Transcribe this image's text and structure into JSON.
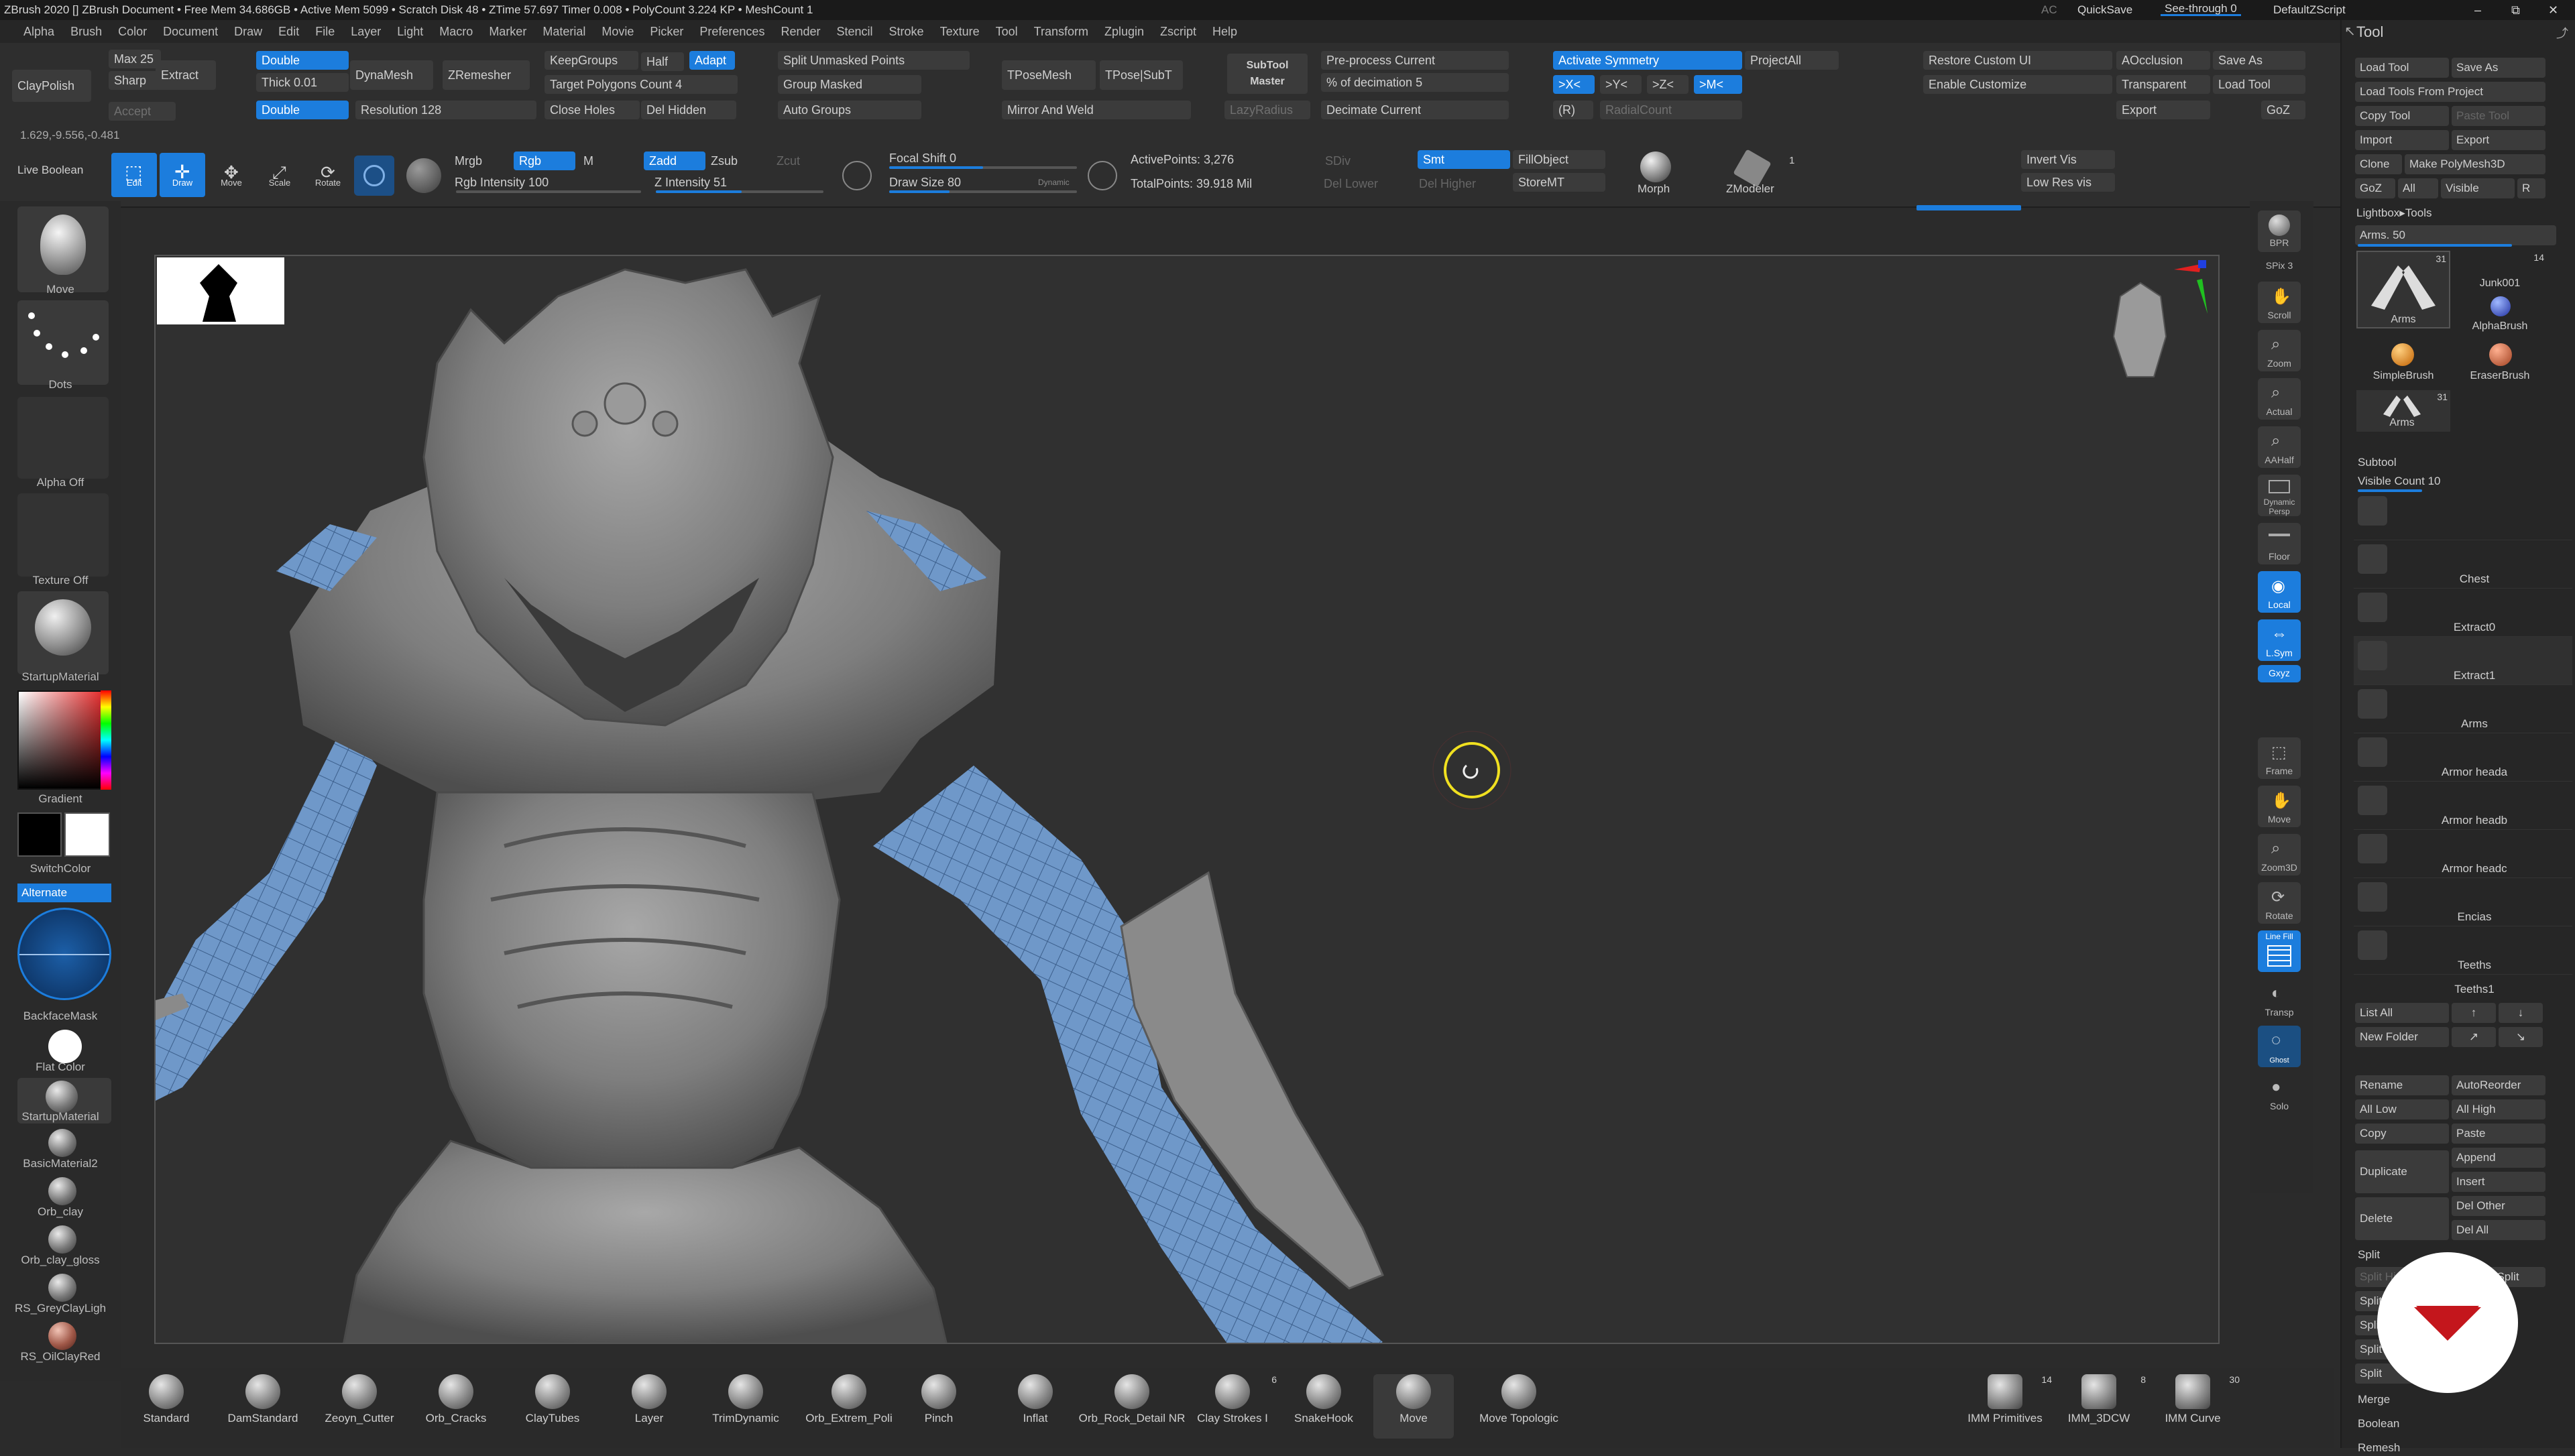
{
  "titlebar": {
    "text": "ZBrush 2020 []   ZBrush Document    •  Free Mem 34.686GB • Active Mem 5099 • Scratch Disk 48 • ZTime 57.697 Timer 0.008 • PolyCount 3.224 KP • MeshCount 1",
    "ac": "AC",
    "quicksave": "QuickSave",
    "seethrough": "See-through  0",
    "defaultzscript": "DefaultZScript"
  },
  "menu": [
    "Alpha",
    "Brush",
    "Color",
    "Document",
    "Draw",
    "Edit",
    "File",
    "Layer",
    "Light",
    "Macro",
    "Marker",
    "Material",
    "Movie",
    "Picker",
    "Preferences",
    "Render",
    "Stencil",
    "Stroke",
    "Texture",
    "Tool",
    "Transform",
    "Zplugin",
    "Zscript",
    "Help"
  ],
  "shelf": {
    "claypolish": "ClayPolish",
    "max": "Max 25",
    "sharp": "Sharp",
    "extract": "Extract",
    "accept": "Accept",
    "double1": "Double",
    "thick": "Thick 0.01",
    "double2": "Double",
    "dynamesh": "DynaMesh",
    "zremesher": "ZRemesher",
    "keepgroups": "KeepGroups",
    "half": "Half",
    "adapt": "Adapt",
    "target": "Target Polygons Count 4",
    "resolution": "Resolution 128",
    "closeholes": "Close Holes",
    "delhidden": "Del Hidden",
    "split_unmasked": "Split Unmasked Points",
    "group_masked": "Group Masked",
    "auto_groups": "Auto Groups",
    "tposemesh": "TPoseMesh",
    "tpose_subt": "TPose|SubT",
    "mirror_weld": "Mirror And Weld",
    "subtool_master": "SubTool Master",
    "lazyradius": "LazyRadius",
    "preprocess": "Pre-process Current",
    "decimation": "% of decimation 5",
    "decimate_current": "Decimate Current",
    "activate_sym": "Activate Symmetry",
    "sym_x": ">X<",
    "sym_y": ">Y<",
    "sym_z": ">Z<",
    "sym_m": ">M<",
    "sym_r": "(R)",
    "radialcount": "RadialCount",
    "projectall": "ProjectAll",
    "restore_ui": "Restore Custom UI",
    "enable_customize": "Enable Customize",
    "aocclusion": "AOcclusion",
    "transparent": "Transparent",
    "export": "Export",
    "saveas": "Save As",
    "loadtool": "Load Tool",
    "goz": "GoZ",
    "coords": "1.629,-9.556,-0.481",
    "live_boolean": "Live Boolean",
    "edit": "Edit",
    "draw": "Draw",
    "move": "Move",
    "scale": "Scale",
    "rotate": "Rotate",
    "mrgb": "Mrgb",
    "rgb": "Rgb",
    "m": "M",
    "rgb_intensity": "Rgb Intensity 100",
    "zadd": "Zadd",
    "zsub": "Zsub",
    "zcut": "Zcut",
    "z_intensity": "Z Intensity 51",
    "focal_shift": "Focal Shift 0",
    "draw_size": "Draw Size 80",
    "dynamic": "Dynamic",
    "active_points": "ActivePoints: 3,276",
    "total_points": "TotalPoints: 39.918 Mil",
    "sdiv": "SDiv",
    "smt": "Smt",
    "fillobject": "FillObject",
    "del_lower": "Del Lower",
    "del_higher": "Del Higher",
    "storemt": "StoreMT",
    "morph": "Morph",
    "zmodeler": "ZModeler",
    "zmodeler_count": "1",
    "invert_vis": "Invert Vis",
    "low_res_vis": "Low Res vis"
  },
  "left": {
    "brush": "Move",
    "stroke": "Dots",
    "alpha": "Alpha Off",
    "texture": "Texture Off",
    "material": "StartupMaterial",
    "gradient": "Gradient",
    "switchcolor": "SwitchColor",
    "alternate": "Alternate",
    "backfacemask": "BackfaceMask",
    "materials": [
      "Flat Color",
      "StartupMaterial",
      "BasicMaterial2",
      "Orb_clay",
      "Orb_clay_gloss",
      "RS_GreyClayLigh",
      "RS_OilClayRed"
    ]
  },
  "rightstrip": [
    "BPR",
    "SPix 3",
    "Scroll",
    "Zoom",
    "Actual",
    "AAHalf",
    "Dynamic Persp",
    "Floor",
    "Local",
    "L.Sym",
    "Gxyz",
    "Frame",
    "Move",
    "Zoom3D",
    "Rotate",
    "Line Fill",
    "Transp",
    "Ghost",
    "Solo"
  ],
  "toolpanel": {
    "title": "Tool",
    "load_tool": "Load Tool",
    "save_as": "Save As",
    "load_tools_from_project": "Load Tools From Project",
    "copy_tool": "Copy Tool",
    "paste_tool": "Paste Tool",
    "import": "Import",
    "export": "Export",
    "clone": "Clone",
    "make_polymesh": "Make PolyMesh3D",
    "goz": "GoZ",
    "all": "All",
    "visible": "Visible",
    "r": "R",
    "lightbox_tools": "Lightbox▸Tools",
    "arms_slider": "Arms. 50",
    "thumbs": [
      {
        "name": "Arms",
        "count": "31"
      },
      {
        "name": "Junk001",
        "count": "14"
      },
      {
        "name": "AlphaBrush",
        "count": ""
      },
      {
        "name": "SimpleBrush",
        "count": ""
      },
      {
        "name": "EraserBrush",
        "count": ""
      },
      {
        "name": "Arms",
        "count": "31"
      }
    ],
    "subtool_title": "Subtool",
    "visible_count": "Visible Count 10",
    "subtools": [
      "",
      "Chest",
      "Extract0",
      "Extract1",
      "Arms",
      "Armor heada",
      "Armor headb",
      "Armor headc",
      "Encias",
      "Teeths",
      "Teeths1"
    ],
    "list_all": "List All",
    "new_folder": "New Folder",
    "rename": "Rename",
    "autoreorder": "AutoReorder",
    "all_low": "All Low",
    "all_high": "All High",
    "copy": "Copy",
    "paste": "Paste",
    "append": "Append",
    "duplicate": "Duplicate",
    "insert": "Insert",
    "delete": "Delete",
    "del_other": "Del Other",
    "del_all": "Del All",
    "split": "Split",
    "split_hidden": "Split Hidden",
    "groups_split": "Groups Split",
    "split_t": "Split T",
    "split_2": "Split",
    "split_3": "Split",
    "split_4": "Split",
    "merge": "Merge",
    "boolean": "Boolean",
    "remesh": "Remesh"
  },
  "brushes": [
    "Standard",
    "DamStandard",
    "Zeoyn_Cutter",
    "Orb_Cracks",
    "ClayTubes",
    "Layer",
    "TrimDynamic",
    "Orb_Extrem_Poli",
    "Pinch",
    "Inflat",
    "Orb_Rock_Detail NR",
    "Clay Strokes I",
    "SnakeHook",
    "Move",
    "Move Topologic"
  ],
  "brush_counts": {
    "clay_strokes": "6"
  },
  "imm": [
    {
      "name": "IMM Primitives",
      "count": "14"
    },
    {
      "name": "IMM_3DCW",
      "count": "8"
    },
    {
      "name": "IMM Curve",
      "count": "30"
    }
  ],
  "colors": {
    "accent": "#1c7ddd",
    "mesh": "#8c8c8c",
    "arm": "#6f98c9",
    "cursor": "#f0e020"
  }
}
